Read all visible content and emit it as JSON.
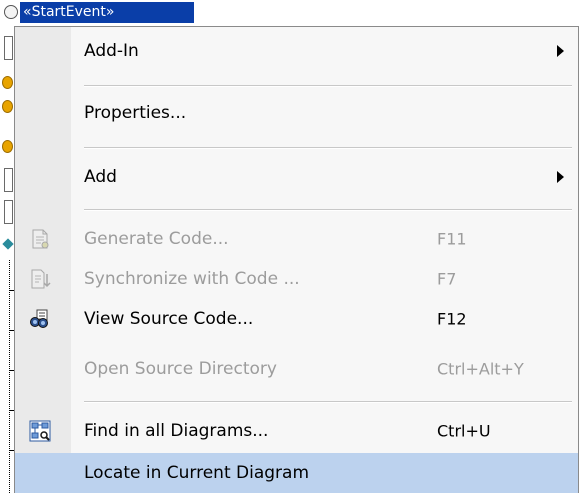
{
  "diagram_element": {
    "label": "«StartEvent»"
  },
  "context_menu": {
    "items": [
      {
        "label": "Add-In",
        "shortcut": "",
        "disabled": false,
        "has_submenu": true,
        "icon": ""
      },
      {
        "label": "Properties...",
        "shortcut": "",
        "disabled": false,
        "has_submenu": false,
        "icon": ""
      },
      {
        "label": "Add",
        "shortcut": "",
        "disabled": false,
        "has_submenu": true,
        "icon": ""
      },
      {
        "label": "Generate Code...",
        "shortcut": "F11",
        "disabled": true,
        "has_submenu": false,
        "icon": "generate-code-icon"
      },
      {
        "label": "Synchronize with Code ...",
        "shortcut": "F7",
        "disabled": true,
        "has_submenu": false,
        "icon": "synchronize-code-icon"
      },
      {
        "label": "View Source Code...",
        "shortcut": "F12",
        "disabled": false,
        "has_submenu": false,
        "icon": "view-source-binoculars-icon"
      },
      {
        "label": "Open Source Directory",
        "shortcut": "Ctrl+Alt+Y",
        "disabled": true,
        "has_submenu": false,
        "icon": ""
      },
      {
        "label": "Find in all Diagrams...",
        "shortcut": "Ctrl+U",
        "disabled": false,
        "has_submenu": false,
        "icon": "find-diagrams-icon"
      },
      {
        "label": "Locate in Current Diagram",
        "shortcut": "",
        "disabled": false,
        "has_submenu": false,
        "icon": "",
        "highlighted": true
      }
    ]
  },
  "colors": {
    "menu_background": "#f7f7f7",
    "highlight": "#bcd2ee",
    "title_chip": "#0a3ea8",
    "disabled_text": "#9c9c9c"
  }
}
